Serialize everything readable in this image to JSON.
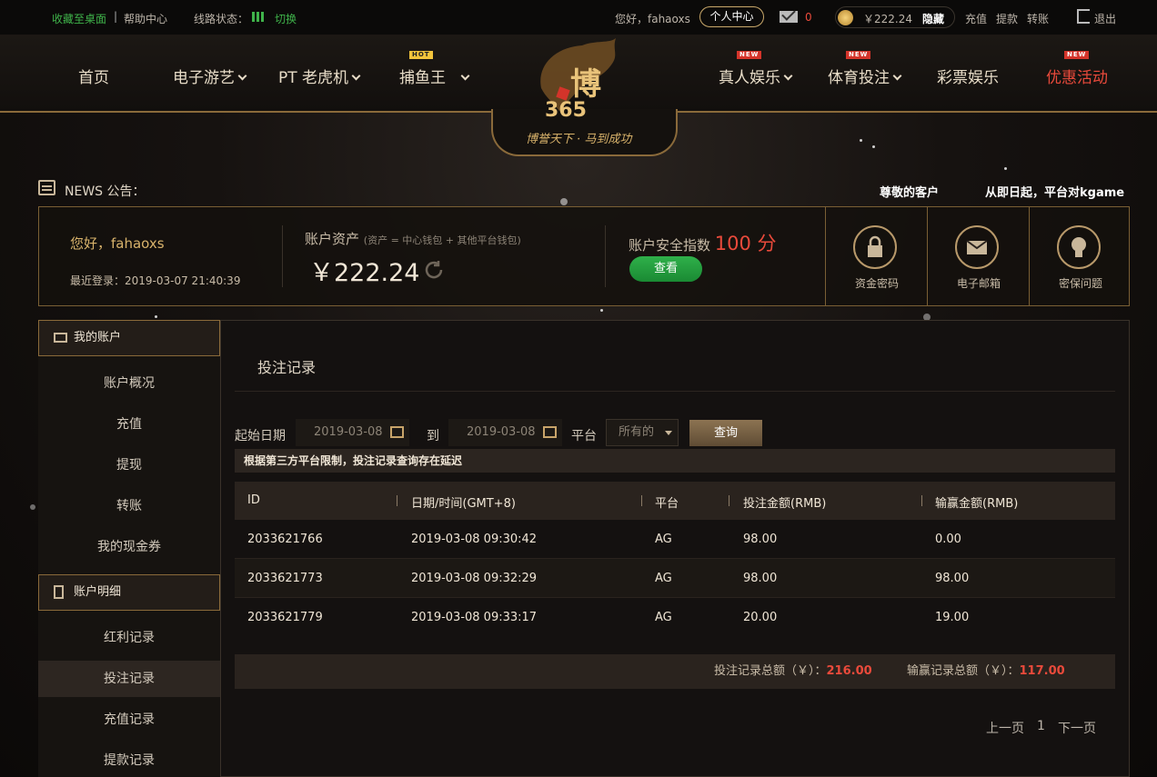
{
  "topbar": {
    "bookmark": "收藏至桌面",
    "help": "帮助中心",
    "line_status_label": "线路状态：",
    "switch": "切换",
    "greeting": "您好，fahaoxs",
    "personal_center": "个人中心",
    "mail_count": "0",
    "balance": "￥222.24",
    "hide": "隐藏",
    "deposit": "充值",
    "withdraw": "提款",
    "transfer": "转账",
    "logout": "退出"
  },
  "nav": {
    "left": [
      {
        "label": "首页"
      },
      {
        "label": "电子游艺"
      },
      {
        "label": "PT 老虎机"
      },
      {
        "label": "捕鱼王",
        "badge": "HOT"
      }
    ],
    "right": [
      {
        "label": "真人娱乐",
        "badge": "NEW"
      },
      {
        "label": "体育投注",
        "badge": "NEW"
      },
      {
        "label": "彩票娱乐"
      },
      {
        "label": "优惠活动",
        "badge": "NEW"
      }
    ],
    "logo_slogan": "博誉天下 · 马到成功"
  },
  "news": {
    "label": "NEWS 公告：",
    "text1": "尊敬的客户",
    "text2": "从即日起，平台对kgame"
  },
  "account": {
    "greeting": "您好，fahaoxs",
    "last_login": "最近登录：2019-03-07 21:40:39",
    "assets_label": "账户资产",
    "assets_note": "(资产 = 中心钱包 + 其他平台钱包)",
    "assets_value": "￥222.24",
    "security_label": "账户安全指数",
    "security_score": "100 分",
    "view_button": "查看",
    "icons": [
      {
        "label": "资金密码",
        "icon": "lock-icon"
      },
      {
        "label": "电子邮箱",
        "icon": "envelope-icon"
      },
      {
        "label": "密保问题",
        "icon": "lightbulb-icon"
      }
    ]
  },
  "sidebar": {
    "group1_title": "我的账户",
    "group1_items": [
      "账户概况",
      "充值",
      "提现",
      "转账",
      "我的现金券"
    ],
    "group2_title": "账户明细",
    "group2_items": [
      "红利记录",
      "投注记录",
      "充值记录",
      "提款记录"
    ],
    "active": "投注记录"
  },
  "main": {
    "title": "投注记录",
    "start_label": "起始日期",
    "start_date": "2019-03-08",
    "to_label": "到",
    "end_date": "2019-03-08",
    "platform_label": "平台",
    "platform_value": "所有的",
    "query_button": "查询",
    "notice": "根据第三方平台限制，投注记录查询存在延迟",
    "columns": [
      "ID",
      "日期/时间(GMT+8)",
      "平台",
      "投注金额(RMB)",
      "输赢金额(RMB)"
    ],
    "rows": [
      [
        "2033621766",
        "2019-03-08 09:30:42",
        "AG",
        "98.00",
        "0.00"
      ],
      [
        "2033621773",
        "2019-03-08 09:32:29",
        "AG",
        "98.00",
        "98.00"
      ],
      [
        "2033621779",
        "2019-03-08 09:33:17",
        "AG",
        "20.00",
        "19.00"
      ]
    ],
    "bet_total_label": "投注记录总额（￥）：",
    "bet_total": "216.00",
    "win_total_label": "输赢记录总额（￥）：",
    "win_total": "117.00",
    "prev_page": "上一页",
    "page_num": "1",
    "next_page": "下一页"
  },
  "colors": {
    "accent_gold": "#c9a86a",
    "green": "#3fb34a",
    "red": "#e94a3b"
  }
}
